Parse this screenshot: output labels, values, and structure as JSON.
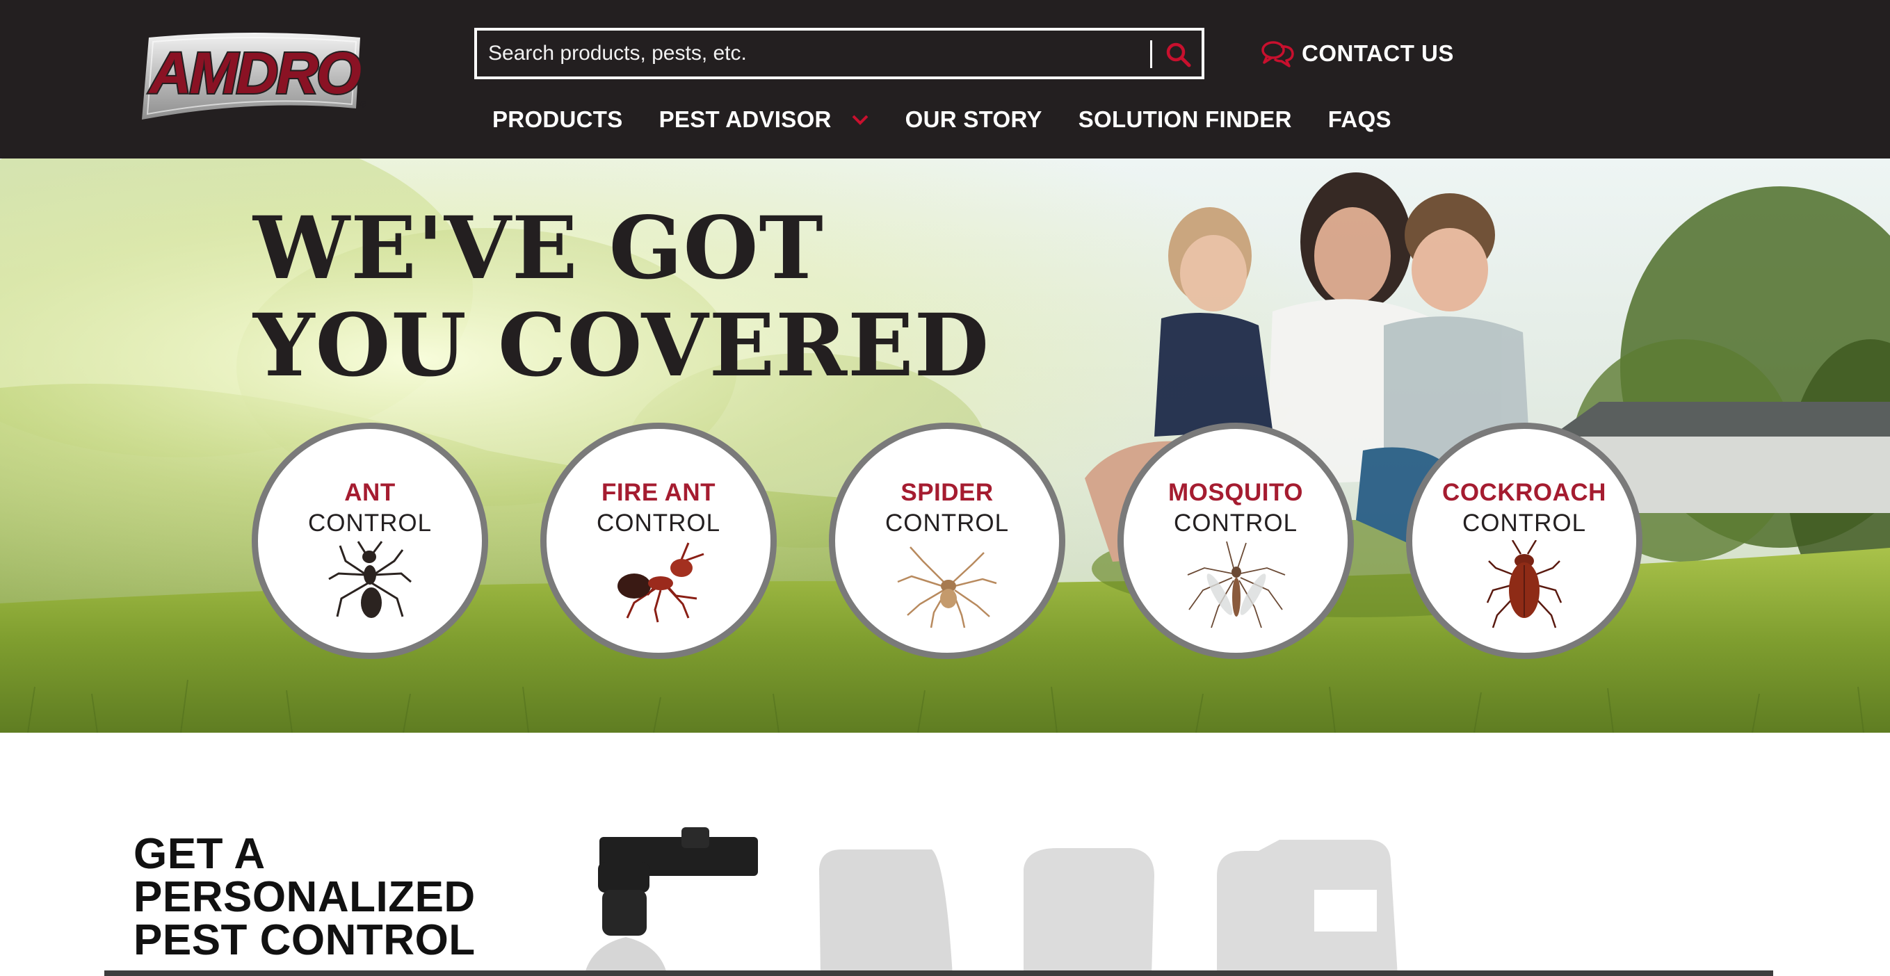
{
  "header": {
    "logo_text": "AMDRO",
    "search": {
      "placeholder": "Search products, pests, etc."
    },
    "contact_label": "CONTACT US",
    "nav": [
      {
        "label": "PRODUCTS"
      },
      {
        "label": "PEST ADVISOR",
        "has_dropdown": true
      },
      {
        "label": "OUR STORY"
      },
      {
        "label": "SOLUTION FINDER"
      },
      {
        "label": "FAQS"
      }
    ]
  },
  "hero": {
    "headline_line1": "WE'VE GOT",
    "headline_line2": "YOU COVERED",
    "pests": [
      {
        "name": "ANT",
        "sub": "CONTROL",
        "icon": "ant-icon"
      },
      {
        "name": "FIRE ANT",
        "sub": "CONTROL",
        "icon": "fire-ant-icon"
      },
      {
        "name": "SPIDER",
        "sub": "CONTROL",
        "icon": "spider-icon"
      },
      {
        "name": "MOSQUITO",
        "sub": "CONTROL",
        "icon": "mosquito-icon"
      },
      {
        "name": "COCKROACH",
        "sub": "CONTROL",
        "icon": "cockroach-icon"
      }
    ]
  },
  "section": {
    "title_line1": "GET A",
    "title_line2": "PERSONALIZED",
    "title_line3": "PEST CONTROL"
  },
  "colors": {
    "header_bg": "#231f20",
    "accent_red": "#a51c30",
    "circle_border": "#7a7a7a"
  }
}
